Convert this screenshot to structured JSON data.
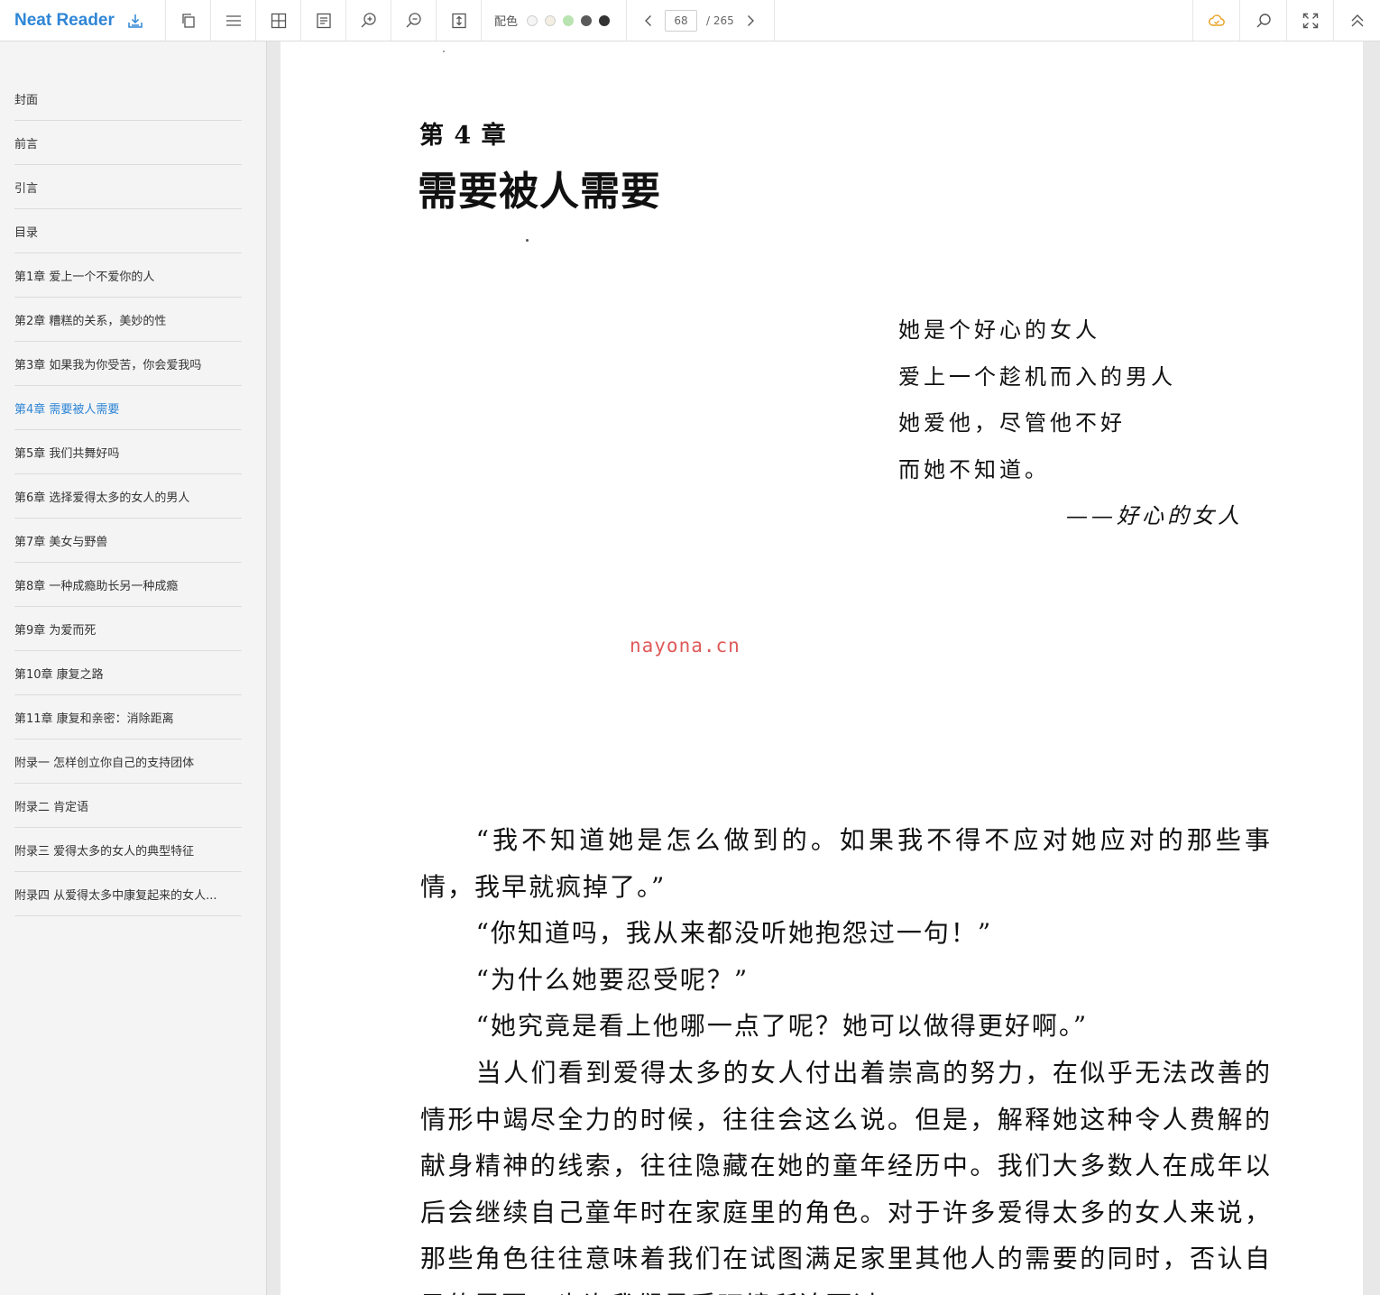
{
  "app": {
    "name": "Neat Reader"
  },
  "toolbar": {
    "theme_label": "配色",
    "theme_colors": [
      "#f5f5f5",
      "#f4efe2",
      "#b9e3b0",
      "#5a5a5a",
      "#333333"
    ],
    "current_page": "68",
    "total_pages": "/ 265"
  },
  "toc": {
    "active_index": 7,
    "items": [
      "封面",
      "前言",
      "引言",
      "目录",
      "第1章 爱上一个不爱你的人",
      "第2章 糟糕的关系，美妙的性",
      "第3章 如果我为你受苦，你会爱我吗",
      "第4章 需要被人需要",
      "第5章 我们共舞好吗",
      "第6章 选择爱得太多的女人的男人",
      "第7章 美女与野兽",
      "第8章 一种成瘾助长另一种成瘾",
      "第9章 为爱而死",
      "第10章 康复之路",
      "第11章 康复和亲密：消除距离",
      "附录一 怎样创立你自己的支持团体",
      "附录二 肯定语",
      "附录三 爱得太多的女人的典型特征",
      "附录四 从爱得太多中康复起来的女人..."
    ]
  },
  "page": {
    "chapter_number": "第 4 章",
    "chapter_title": "需要被人需要",
    "epigraph": {
      "lines": [
        "她是个好心的女人",
        "爱上一个趁机而入的男人",
        "她爱他，尽管他不好",
        "而她不知道。"
      ],
      "source": "——好心的女人"
    },
    "watermark": "nayona.cn",
    "paragraphs": [
      "“我不知道她是怎么做到的。如果我不得不应对她应对的那些事情，我早就疯掉了。”",
      "“你知道吗，我从来都没听她抱怨过一句！”",
      "“为什么她要忍受呢？”",
      "“她究竟是看上他哪一点了呢？她可以做得更好啊。”",
      "当人们看到爱得太多的女人付出着崇高的努力，在似乎无法改善的情形中竭尽全力的时候，往往会这么说。但是，解释她这种令人费解的献身精神的线索，往往隐藏在她的童年经历中。我们大多数人在成年以后会继续自己童年时在家庭里的角色。对于许多爱得太多的女人来说，那些角色往往意味着我们在试图满足家里其他人的需要的同时，否认自己的需要。也许我们是受环境所迫而过"
    ]
  }
}
